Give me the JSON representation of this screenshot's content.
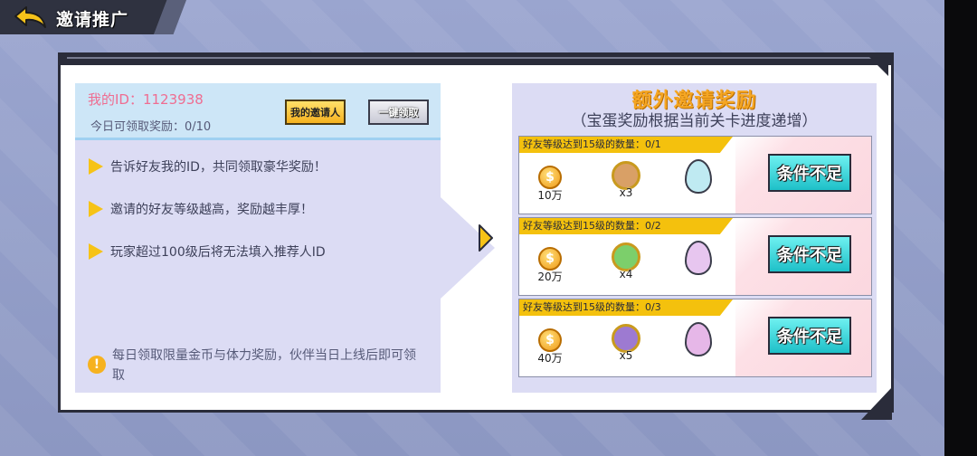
{
  "header": {
    "title": "邀请推广"
  },
  "left_panel": {
    "my_id": "我的ID：1123938",
    "today_claim": "今日可领取奖励：0/10",
    "inviter_button": "我的邀请人",
    "claim_all_button": "一键领取",
    "tips": [
      "告诉好友我的ID，共同领取豪华奖励！",
      "邀请的好友等级越高，奖励越丰厚！",
      "玩家超过100级后将无法填入推荐人ID"
    ],
    "note": "每日领取限量金币与体力奖励，伙伴当日上线后即可领取"
  },
  "right_panel": {
    "title": "额外邀请奖励",
    "subtitle": "（宝蛋奖励根据当前关卡进度递增）",
    "rows": [
      {
        "label": "好友等级达到15级的数量：0/1",
        "coin_qty": "10万",
        "hero_qty": "x3",
        "egg_color": "#bfeaf2",
        "hero_color": "#d9a066",
        "status": "条件不足"
      },
      {
        "label": "好友等级达到15级的数量：0/2",
        "coin_qty": "20万",
        "hero_qty": "x4",
        "egg_color": "#e7c6ef",
        "hero_color": "#7ccf6b",
        "status": "条件不足"
      },
      {
        "label": "好友等级达到15级的数量：0/3",
        "coin_qty": "40万",
        "hero_qty": "x5",
        "egg_color": "#e6b7e8",
        "hero_color": "#9d7ad1",
        "status": "条件不足"
      }
    ]
  },
  "colors": {
    "accent_yellow": "#f4c10d",
    "button_cyan": "#1ec0c8",
    "id_pink": "#ef6d91",
    "panel_lavender": "#dcdcf4"
  }
}
